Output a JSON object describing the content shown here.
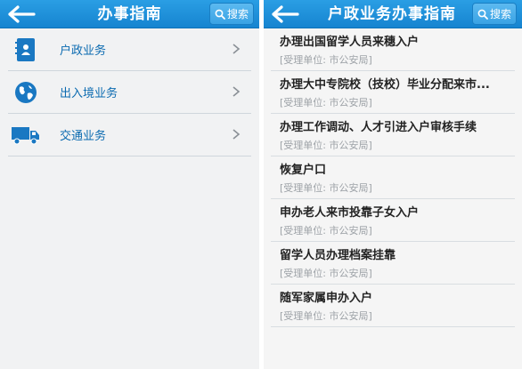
{
  "left": {
    "title": "办事指南",
    "search_label": "搜索",
    "categories": [
      {
        "label": "户政业务",
        "icon": "id-book-icon"
      },
      {
        "label": "出入境业务",
        "icon": "globe-icon"
      },
      {
        "label": "交通业务",
        "icon": "truck-icon"
      }
    ]
  },
  "right": {
    "title": "户政业务办事指南",
    "search_label": "搜索",
    "items": [
      {
        "name": "办理出国留学人员来穗入户",
        "unit": "[受理单位: 市公安局]"
      },
      {
        "name": "办理大中专院校（技校）毕业分配来市...",
        "unit": "[受理单位: 市公安局]"
      },
      {
        "name": "办理工作调动、人才引进入户审核手续",
        "unit": "[受理单位: 市公安局]"
      },
      {
        "name": "恢复户口",
        "unit": "[受理单位: 市公安局]"
      },
      {
        "name": "申办老人来市投靠子女入户",
        "unit": "[受理单位: 市公安局]"
      },
      {
        "name": "留学人员办理档案挂靠",
        "unit": "[受理单位: 市公安局]"
      },
      {
        "name": "随军家属申办入户",
        "unit": "[受理单位: 市公安局]"
      }
    ]
  },
  "colors": {
    "header": "#1684d0",
    "category_text": "#0a6ab0"
  }
}
